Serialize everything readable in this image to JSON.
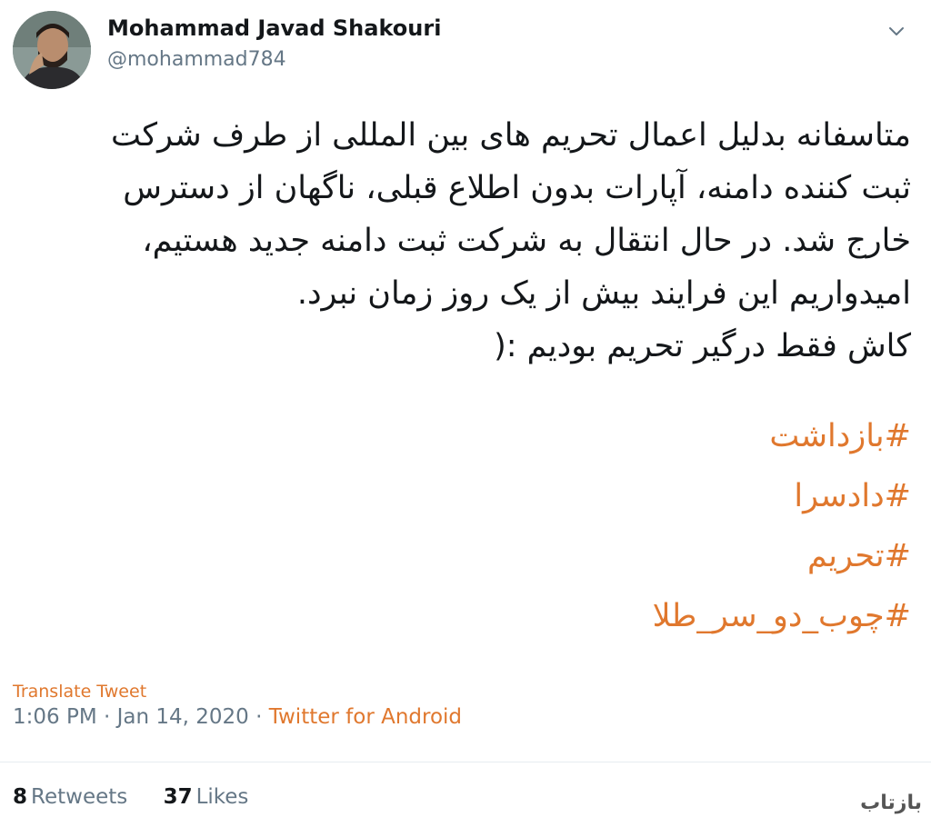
{
  "author": {
    "display_name": "Mohammad Javad Shakouri",
    "handle": "@mohammad784"
  },
  "tweet": {
    "lines": [
      "متاسفانه بدلیل اعمال تحریم های بین المللی از طرف شرکت",
      "ثبت کننده دامنه، آپارات بدون اطلاع قبلی، ناگهان از دسترس",
      "خارج شد. در حال انتقال به شرکت ثبت دامنه جدید هستیم،",
      "امیدواریم این فرایند بیش از یک روز زمان نبرد.",
      "کاش فقط درگیر تحریم بودیم  :("
    ],
    "hashtags": [
      "#بازداشت",
      "#دادسرا",
      "#تحریم",
      "#چوب_دو_سر_طلا"
    ]
  },
  "translate_label": "Translate Tweet",
  "meta": {
    "time": "1:06 PM",
    "separator": "·",
    "date": "Jan 14, 2020",
    "source": "Twitter for Android"
  },
  "stats": {
    "retweets_count": "8",
    "retweets_label": "Retweets",
    "likes_count": "37",
    "likes_label": "Likes"
  },
  "watermark": "بازتاب",
  "icons": {
    "caret": "chevron-down-icon"
  },
  "colors": {
    "link": "#e0782e",
    "secondary": "#657786",
    "primary": "#14171a"
  }
}
